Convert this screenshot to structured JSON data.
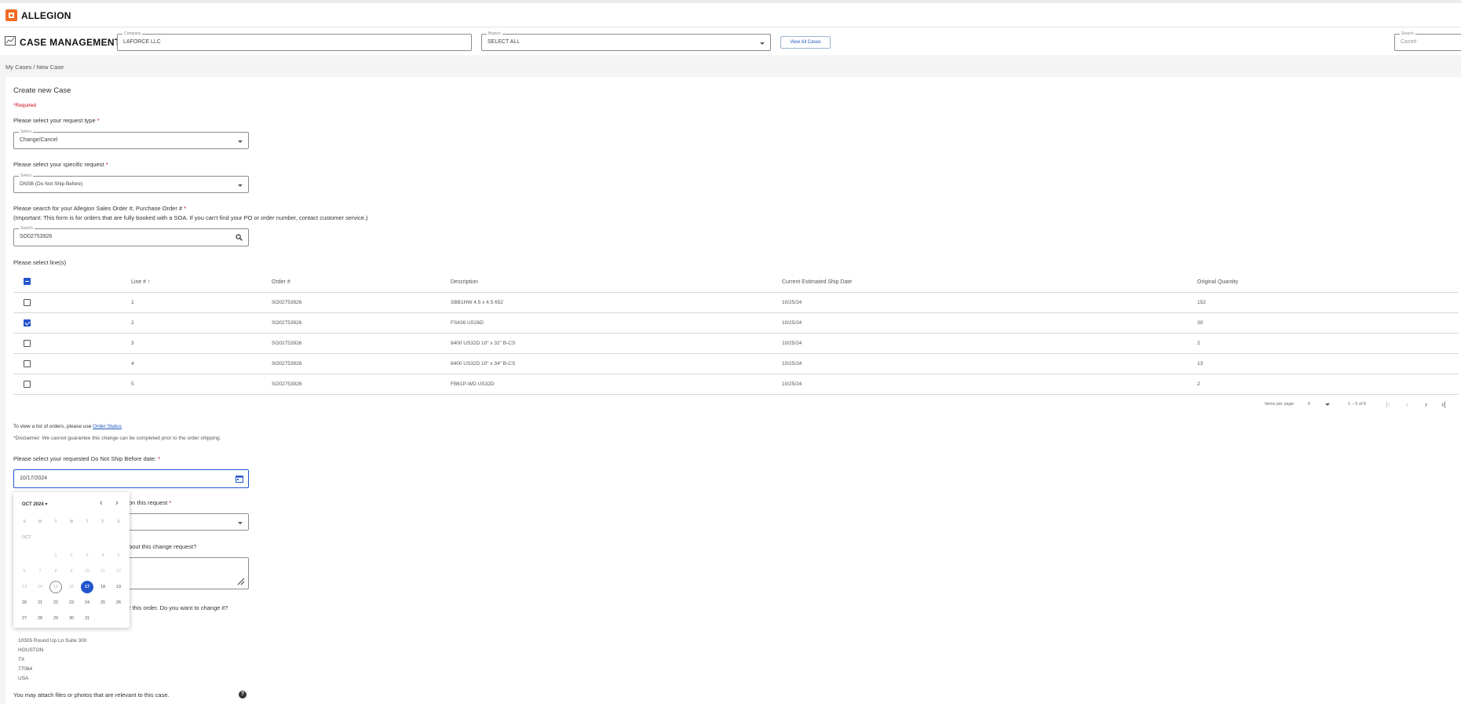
{
  "brand": {
    "name": "ALLEGION",
    "accent": "#f26b21"
  },
  "header": {
    "title": "CASE MANAGEMENT",
    "company": {
      "label": "Company",
      "value": "LAFORCE LLC"
    },
    "branch": {
      "label": "Branch",
      "value": "SELECT ALL"
    },
    "view_all_label": "View All Cases",
    "search": {
      "label": "Search",
      "placeholder": "Case#"
    }
  },
  "breadcrumb": "My Cases / New Case",
  "form": {
    "title": "Create new Case",
    "required_note": "*Required",
    "request_type": {
      "question": "Please select your request type",
      "label": "Select",
      "value": "Change/Cancel"
    },
    "specific_request": {
      "question": "Please select your specific request",
      "label": "Select",
      "value": "DNSB (Do Not Ship Before)"
    },
    "order_search": {
      "question": "Please search for your Allegion Sales Order #, Purchase Order #",
      "important": "(Important: This form is for orders that are fully booked with a SOA. If you can't find your PO or order number, contact customer service.)",
      "label": "Search",
      "value": "SO02753926"
    },
    "lines_prompt": "Please select line(s)",
    "table": {
      "headers": [
        "Line #",
        "Order #",
        "Description",
        "Current Estimated Ship Date",
        "Original Quantity"
      ],
      "sort_indicator": "↑",
      "rows": [
        {
          "line": "1",
          "order": "SO02753926",
          "description": "SBB1HW 4.5 x 4.5 652",
          "ship_date": "10/25/24",
          "qty": "152",
          "checked": false
        },
        {
          "line": "2",
          "order": "SO02753926",
          "description": "FS436 US26D",
          "ship_date": "10/25/24",
          "qty": "30",
          "checked": true
        },
        {
          "line": "3",
          "order": "SO02753926",
          "description": "8400 US32D 10\" x 32\" B-CS",
          "ship_date": "10/25/24",
          "qty": "2",
          "checked": false
        },
        {
          "line": "4",
          "order": "SO02753926",
          "description": "8400 US32D 10\" x 34\" B-CS",
          "ship_date": "10/25/24",
          "qty": "13",
          "checked": false
        },
        {
          "line": "5",
          "order": "SO02753926",
          "description": "FB61P-WD US32D",
          "ship_date": "10/25/24",
          "qty": "2",
          "checked": false
        }
      ]
    },
    "paginator": {
      "items_label": "Items per page:",
      "page_size": "5",
      "range": "1 – 5 of 6"
    },
    "order_status_text": "To view a list of orders, please use ",
    "order_status_link": "Order Status",
    "disclaimer": "*Disclaimer: We cannot guarantee this change can be completed prior to the order shipping.",
    "dnsb_question": "Please select your requested Do Not Ship Before date:",
    "dnsb_value": "10/17/2024",
    "partial_reason": "on this request",
    "partial_comments": "bout this change request?",
    "partial_address_q": "r this order.  Do you want to change it?",
    "address": [
      "10305 Round Up Ln Suite 300",
      "HOUSTON",
      "TX",
      "77064",
      "USA"
    ],
    "attach_text": "You may attach files or photos that are relevant to this case."
  },
  "calendar": {
    "period_label": "OCT 2024",
    "month_label": "OCT",
    "weekdays": [
      "S",
      "M",
      "T",
      "W",
      "T",
      "F",
      "S"
    ],
    "today": 15,
    "selected": 17,
    "first_weekday": 2,
    "days_in_month": 31,
    "first_enabled": 17,
    "accent": "#2255cc"
  }
}
